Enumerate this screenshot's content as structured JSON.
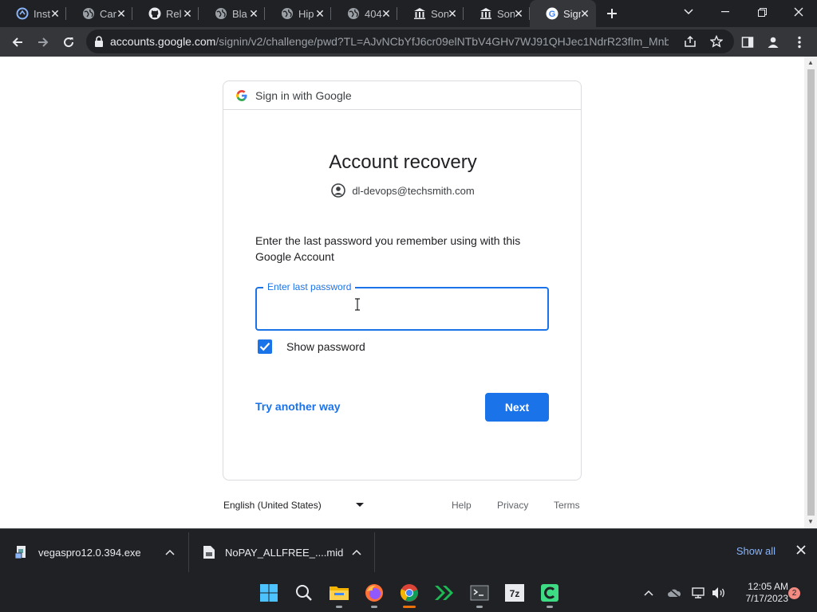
{
  "browser": {
    "tabs": [
      {
        "title": "Inst",
        "icon": "edge-circle-icon"
      },
      {
        "title": "Car",
        "icon": "globe-icon"
      },
      {
        "title": "Rel",
        "icon": "github-icon"
      },
      {
        "title": "Bla",
        "icon": "globe-icon"
      },
      {
        "title": "Hip",
        "icon": "globe-icon"
      },
      {
        "title": "404",
        "icon": "globe-icon"
      },
      {
        "title": "Son",
        "icon": "museum-icon"
      },
      {
        "title": "Son",
        "icon": "museum-icon"
      },
      {
        "title": "Sign",
        "icon": "google-icon",
        "active": true
      }
    ],
    "url_host": "accounts.google.com",
    "url_path": "/signin/v2/challenge/pwd?TL=AJvNCbYfJ6cr09elNTbV4GHv7WJ91QHJec1NdrR23flm_Mnb..."
  },
  "signin": {
    "header": "Sign in with Google",
    "title": "Account recovery",
    "email": "dl-devops@techsmith.com",
    "instruction": "Enter the last password you remember using with this Google Account",
    "field_label": "Enter last password",
    "field_value": "",
    "show_password_label": "Show password",
    "show_password_checked": true,
    "try_another": "Try another way",
    "next": "Next"
  },
  "footer": {
    "language": "English (United States)",
    "help": "Help",
    "privacy": "Privacy",
    "terms": "Terms"
  },
  "downloads": {
    "items": [
      {
        "name": "vegaspro12.0.394.exe"
      },
      {
        "name": "NoPAY_ALLFREE_....mid"
      }
    ],
    "show_all": "Show all"
  },
  "taskbar": {
    "time": "12:05 AM",
    "date": "7/17/2023",
    "notifications": "2"
  },
  "colors": {
    "accent": "#1a73e8",
    "chrome_dark": "#202124",
    "chrome_toolbar": "#35363a"
  }
}
